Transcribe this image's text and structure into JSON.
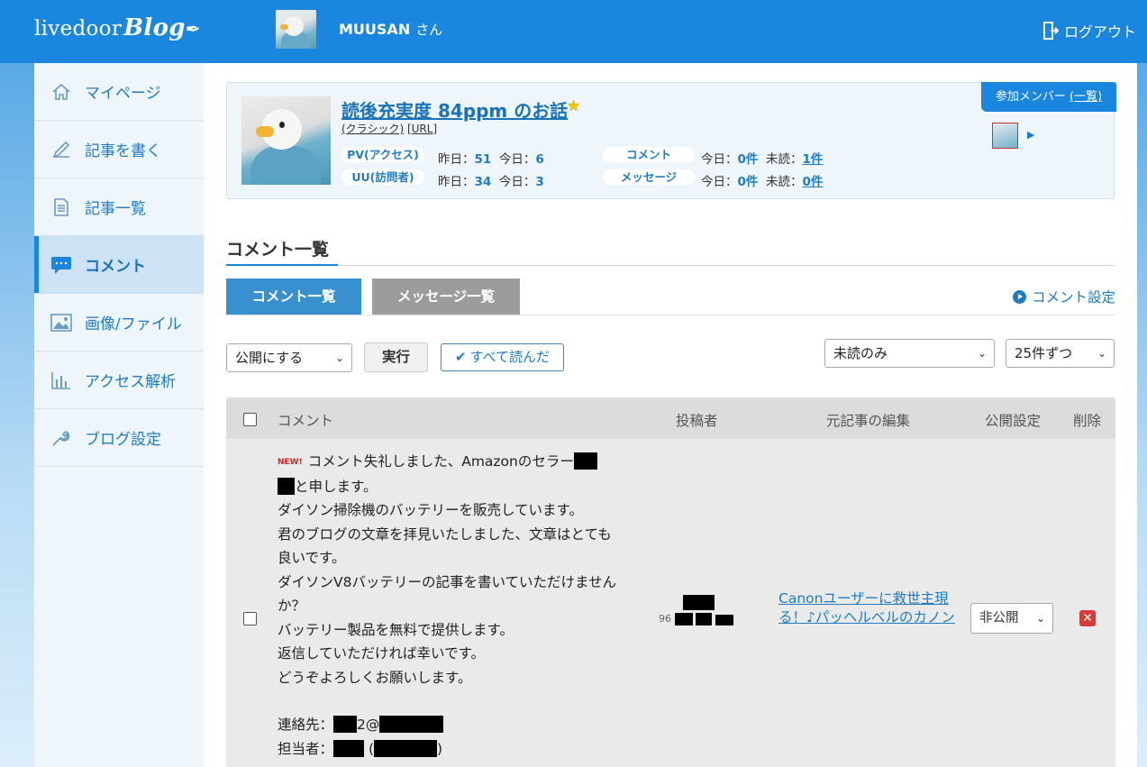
{
  "header": {
    "logo_text": "livedoor",
    "logo_blog": "Blog",
    "username": "MUUSAN",
    "username_suffix": "さん",
    "logout_label": "ログアウト"
  },
  "sidebar": {
    "items": [
      {
        "label": "マイページ",
        "icon": "home-icon"
      },
      {
        "label": "記事を書く",
        "icon": "pencil-icon"
      },
      {
        "label": "記事一覧",
        "icon": "document-list-icon"
      },
      {
        "label": "コメント",
        "icon": "comment-icon",
        "active": true
      },
      {
        "label": "画像/ファイル",
        "icon": "image-icon"
      },
      {
        "label": "アクセス解析",
        "icon": "bar-chart-icon"
      },
      {
        "label": "ブログ設定",
        "icon": "wrench-icon"
      }
    ]
  },
  "blog_card": {
    "title": "読後充実度 84ppm のお話",
    "link_classic": "(クラシック)",
    "link_url": "[URL]",
    "pv_label": "PV(アクセス)",
    "uu_label": "UU(訪問者)",
    "pv_yesterday_label": "昨日：",
    "pv_yesterday": "51",
    "pv_today_label": "今日：",
    "pv_today": "6",
    "uu_yesterday_label": "昨日：",
    "uu_yesterday": "34",
    "uu_today_label": "今日：",
    "uu_today": "3",
    "comment_label": "コメント",
    "message_label": "メッセージ",
    "comment_today_label": "今日：",
    "comment_today": "0件",
    "comment_unread_label": "未読：",
    "comment_unread": "1件",
    "message_today_label": "今日：",
    "message_today": "0件",
    "message_unread_label": "未読：",
    "message_unread": "0件",
    "member_button": "参加メンバー",
    "member_list_link": "(一覧)"
  },
  "comments_page": {
    "title": "コメント一覧",
    "tabs": [
      "コメント一覧",
      "メッセージ一覧"
    ],
    "settings_link": "コメント設定",
    "action_select": "公開にする",
    "run_button": "実行",
    "read_all_button": "すべて読んだ",
    "filter_select": "未読のみ",
    "per_page_select": "25件ずつ"
  },
  "table": {
    "headers": {
      "comment": "コメント",
      "poster": "投稿者",
      "article_edit": "元記事の編集",
      "visibility": "公開設定",
      "delete": "削除"
    },
    "rows": [
      {
        "new_badge": "NEW!",
        "line1": "コメント失礼しました、Amazonのセラー",
        "line2": "と申します。",
        "line3": "ダイソン掃除機のバッテリーを販売しています。",
        "line4": "君のブログの文章を拝見いたしました、文章はとても良いです。",
        "line5": "ダイソンV8バッテリーの記事を書いていただけませんか？",
        "line6": "バッテリー製品を無料で提供します。",
        "line7": "返信していただければ幸いです。",
        "line8": "どうぞよろしくお願いします。",
        "contact_label": "連絡先：",
        "contact_partial": "2@",
        "person_label": "担当者：",
        "poster_ip_prefix": "96",
        "article_title": "Canonユーザーに救世主現る！♪パッヘルベルのカノン",
        "visibility": "非公開"
      }
    ]
  },
  "colors": {
    "header_blue": "#1b86de",
    "link_blue": "#1f7cc4",
    "sidebar_bg": "#eef5fb",
    "delete_red": "#d93a3a"
  }
}
